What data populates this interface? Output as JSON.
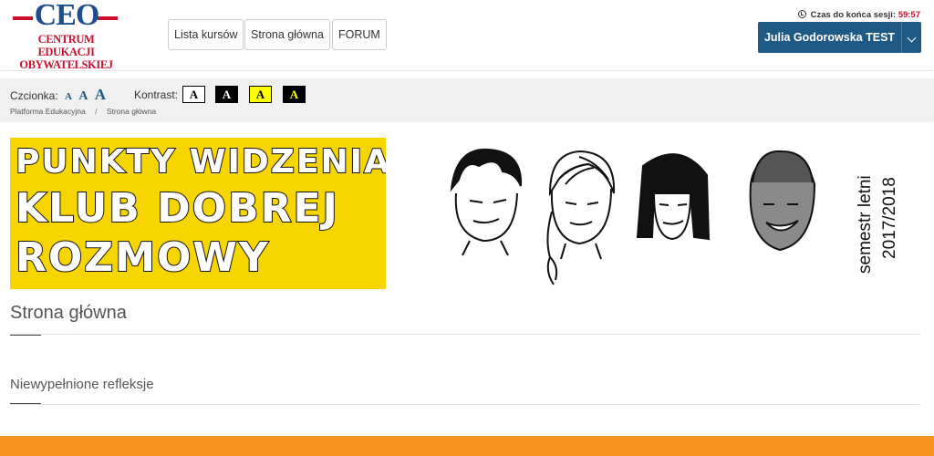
{
  "logo": {
    "mark": "CEO",
    "line1": "CENTRUM EDUKACJI",
    "line2": "OBYWATELSKIEJ"
  },
  "nav": {
    "courses": "Lista kursów",
    "home": "Strona główna",
    "forum": "FORUM"
  },
  "session": {
    "label": "Czas do końca sesji:",
    "time": "59:57"
  },
  "user": {
    "name": "Julia Godorowska TEST"
  },
  "accessibility": {
    "font_label": "Czcionka:",
    "font_sizes": [
      "A",
      "A",
      "A"
    ],
    "contrast_label": "Kontrast:",
    "contrast_options": [
      {
        "letter": "A",
        "bg": "#ffffff",
        "fg": "#000000"
      },
      {
        "letter": "A",
        "bg": "#000000",
        "fg": "#ffffff"
      },
      {
        "letter": "A",
        "bg": "#ffff00",
        "fg": "#000000"
      },
      {
        "letter": "A",
        "bg": "#000000",
        "fg": "#ffff00"
      }
    ]
  },
  "breadcrumb": {
    "items": [
      "Platforma Edukacyjna",
      "Strona główna"
    ],
    "separator": "/"
  },
  "banner": {
    "line1": "PUNKTY WIDZENIA.",
    "line2": "KLUB DOBREJ",
    "line3": "ROZMOWY",
    "semester": "semestr letni",
    "year": "2017/2018"
  },
  "main": {
    "title": "Strona główna",
    "section": "Niewypełnione refleksje"
  },
  "colors": {
    "brand_blue": "#1e5a84",
    "brand_red": "#c8102e",
    "banner_yellow": "#f7d600",
    "orange": "#f7941d"
  }
}
